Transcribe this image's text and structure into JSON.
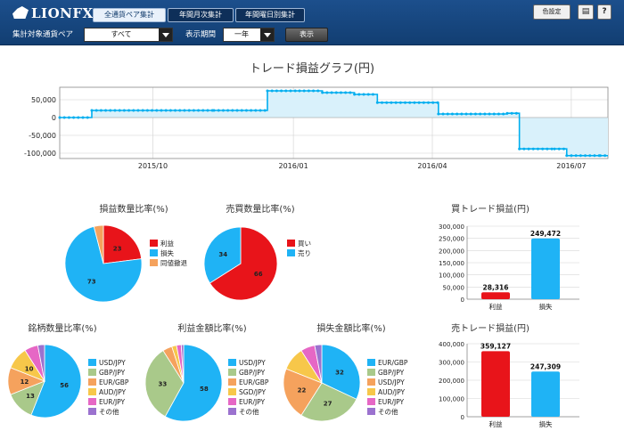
{
  "header": {
    "logo": "LIONFX",
    "tabs": [
      {
        "label": "全通貨ペア集計",
        "active": true
      },
      {
        "label": "年間月次集計",
        "active": false
      },
      {
        "label": "年間曜日別集計",
        "active": false
      }
    ],
    "settings_label": "色設定",
    "currency_pair_label": "集計対象通貨ペア",
    "currency_pair_value": "すべて",
    "period_label": "表示期間",
    "period_value": "一年",
    "show_button": "表示"
  },
  "colors": {
    "header_bg": "#17467f",
    "line": "#00aeef",
    "area": "#d9f1fb",
    "profit": "#e8141a",
    "loss": "#1fb3f5",
    "orange": "#f5a25d",
    "green": "#a9c98a",
    "yellow": "#f7c74a",
    "pink": "#e667c5",
    "purple": "#9b72cf"
  },
  "chart_data": [
    {
      "type": "line",
      "title": "トレード損益グラフ(円)",
      "x": [
        "2015-08-01",
        "2015-08-20",
        "2015-08-22",
        "2015-11-10",
        "2015-12-15",
        "2016-01-05",
        "2016-01-20",
        "2016-02-10",
        "2016-02-25",
        "2016-04-05",
        "2016-05-20",
        "2016-05-28",
        "2016-06-20",
        "2016-06-28",
        "2016-07-20"
      ],
      "values": [
        0,
        0,
        20000,
        20000,
        75000,
        75000,
        70000,
        65000,
        42000,
        10000,
        12000,
        -88000,
        -88000,
        -107000,
        -107000
      ],
      "xticks": [
        "2015/10",
        "2016/01",
        "2016/04",
        "2016/07"
      ],
      "yticks": [
        "50,000",
        "0",
        "-50,000",
        "-100,000"
      ],
      "ylim": [
        -115000,
        85000
      ],
      "grid": true
    },
    {
      "type": "pie",
      "title": "損益数量比率(%)",
      "labels": [
        "利益",
        "損失",
        "同値撤退"
      ],
      "values": [
        23,
        73,
        4
      ],
      "slice_labels": [
        "23",
        "73",
        ""
      ]
    },
    {
      "type": "pie",
      "title": "売買数量比率(%)",
      "labels": [
        "買い",
        "売り"
      ],
      "values": [
        66,
        34
      ],
      "slice_labels": [
        "66",
        "34"
      ]
    },
    {
      "type": "bar",
      "title": "買トレード損益(円)",
      "categories": [
        "利益",
        "損失"
      ],
      "values": [
        28316,
        249472
      ],
      "value_labels": [
        "28,316",
        "249,472"
      ],
      "yticks": [
        "300,000",
        "250,000",
        "200,000",
        "150,000",
        "100,000",
        "50,000",
        "0"
      ],
      "ylim": [
        0,
        300000
      ]
    },
    {
      "type": "pie",
      "title": "銘柄数量比率(%)",
      "labels": [
        "USD/JPY",
        "GBP/JPY",
        "EUR/GBP",
        "AUD/JPY",
        "EUR/JPY",
        "その他"
      ],
      "values": [
        56,
        13,
        12,
        10,
        6,
        3
      ],
      "slice_labels": [
        "56",
        "13",
        "12",
        "10",
        "",
        ""
      ]
    },
    {
      "type": "pie",
      "title": "利益金額比率(%)",
      "labels": [
        "USD/JPY",
        "GBP/JPY",
        "EUR/GBP",
        "SGD/JPY",
        "EUR/JPY",
        "その他"
      ],
      "values": [
        58,
        33,
        4,
        2,
        2,
        1
      ],
      "slice_labels": [
        "58",
        "33",
        "",
        "",
        "",
        ""
      ]
    },
    {
      "type": "pie",
      "title": "損失金額比率(%)",
      "labels": [
        "EUR/GBP",
        "GBP/JPY",
        "USD/JPY",
        "AUD/JPY",
        "EUR/JPY",
        "その他"
      ],
      "values": [
        32,
        27,
        22,
        10,
        6,
        3
      ],
      "slice_labels": [
        "32",
        "27",
        "22",
        "",
        "",
        ""
      ]
    },
    {
      "type": "bar",
      "title": "売トレード損益(円)",
      "categories": [
        "利益",
        "損失"
      ],
      "values": [
        359127,
        247309
      ],
      "value_labels": [
        "359,127",
        "247,309"
      ],
      "yticks": [
        "400,000",
        "300,000",
        "200,000",
        "100,000",
        "0"
      ],
      "ylim": [
        0,
        400000
      ]
    }
  ]
}
